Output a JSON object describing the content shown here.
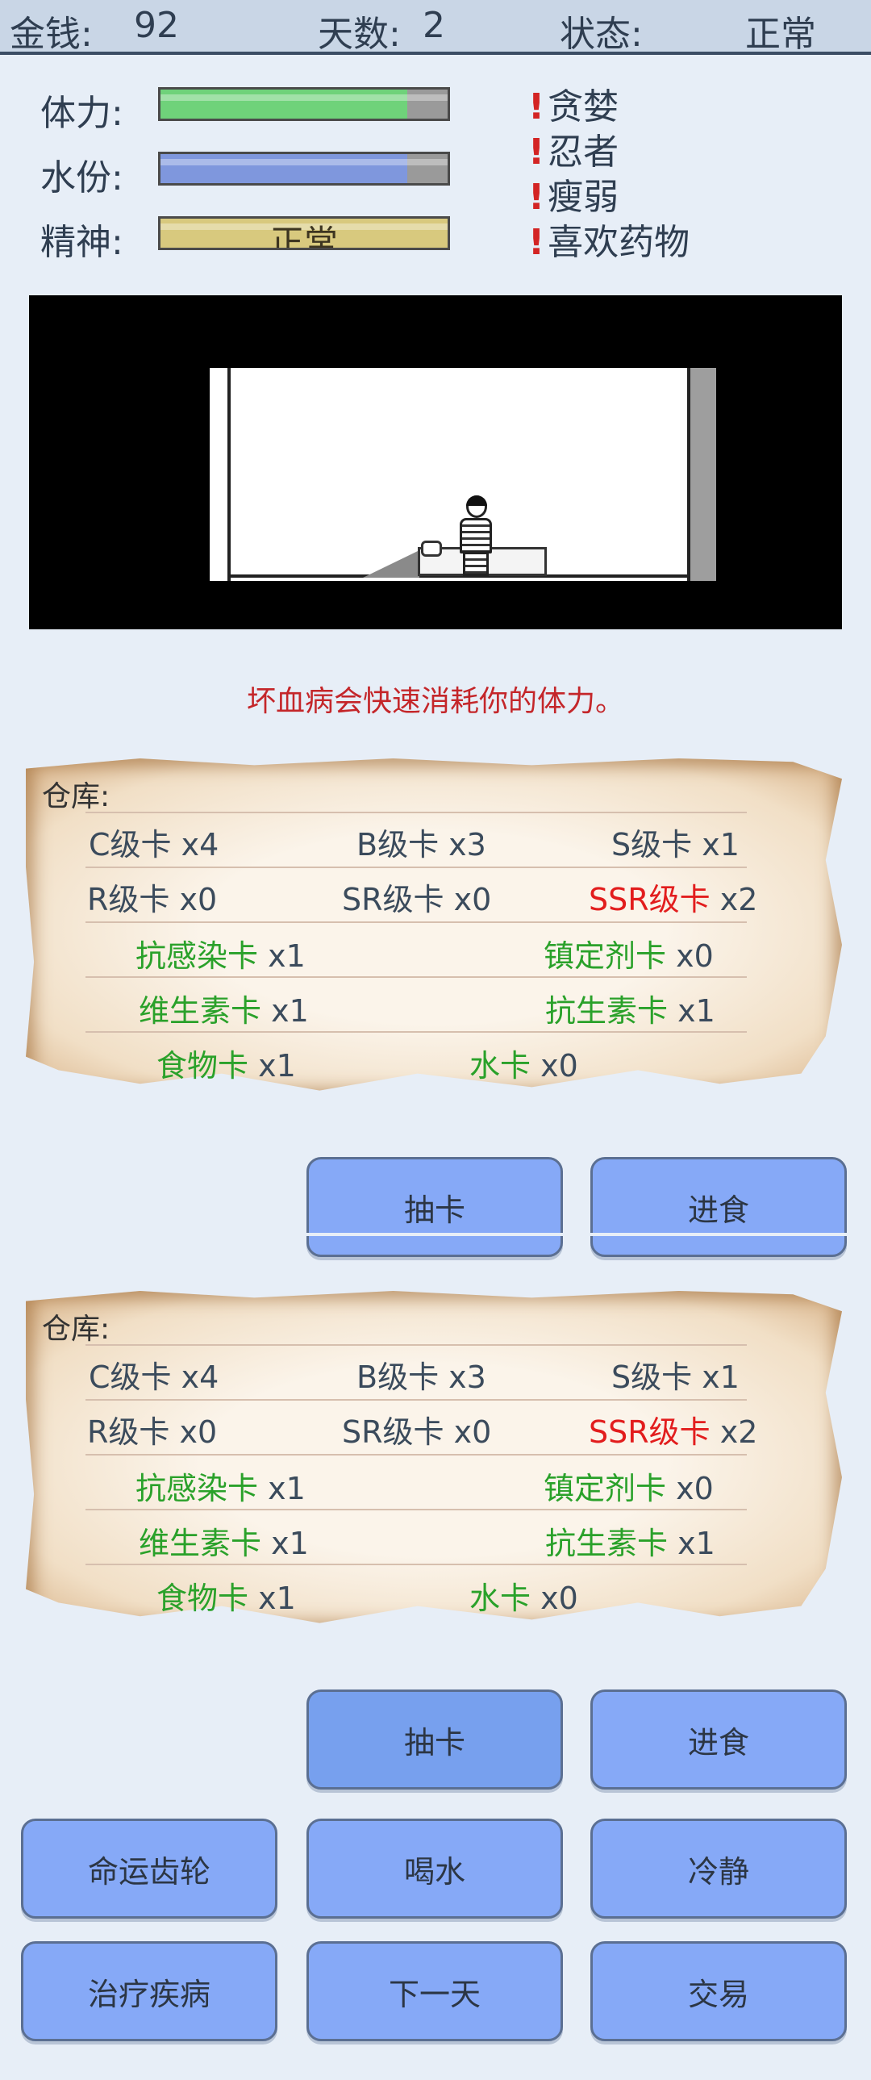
{
  "top": {
    "money_label": "金钱:",
    "money_value": "92",
    "days_label": "天数:",
    "days_value": "2",
    "state_label": "状态:",
    "state_value": "正常"
  },
  "stats": {
    "stamina_label": "体力:",
    "water_label": "水份:",
    "spirit_label": "精神:",
    "spirit_text": "正常",
    "stamina_level": 0.86,
    "water_level": 0.86,
    "spirit_level": 1.0
  },
  "traits": [
    "贪婪",
    "忍者",
    "瘦弱",
    "喜欢药物"
  ],
  "message": "坏血病会快速消耗你的体力。",
  "warehouse": {
    "label": "仓库:",
    "rows": [
      [
        {
          "name": "C级卡",
          "count": "x4"
        },
        {
          "name": "B级卡",
          "count": "x3"
        },
        {
          "name": "S级卡",
          "count": "x1"
        }
      ],
      [
        {
          "name": "R级卡",
          "count": "x0"
        },
        {
          "name": "SR级卡",
          "count": "x0"
        },
        {
          "name": "SSR级卡",
          "count": "x2"
        }
      ],
      [
        {
          "name": "抗感染卡",
          "count": "x1"
        },
        {
          "name": "镇定剂卡",
          "count": "x0"
        }
      ],
      [
        {
          "name": "维生素卡",
          "count": "x1"
        },
        {
          "name": "抗生素卡",
          "count": "x1"
        }
      ],
      [
        {
          "name": "食物卡",
          "count": "x1"
        },
        {
          "name": "水卡",
          "count": "x0"
        }
      ]
    ]
  },
  "buttons": {
    "draw": "抽卡",
    "eat": "进食",
    "fate": "命运齿轮",
    "drink": "喝水",
    "calm": "冷静",
    "treat": "治疗疾病",
    "next_day": "下一天",
    "trade": "交易"
  },
  "colors": {
    "stamina": "#6fd27a",
    "water": "#7f97dd",
    "spirit": "#d8c97e",
    "ssr": "#e21d1d",
    "medicine": "#2aa12a",
    "message": "#c4262a",
    "button": "#86a9f7"
  }
}
